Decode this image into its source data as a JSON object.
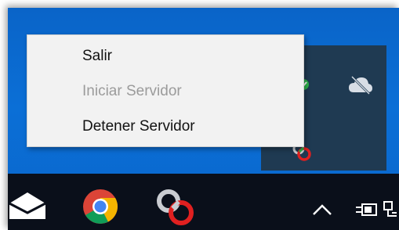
{
  "context_menu": {
    "items": [
      {
        "label": "Salir",
        "enabled": true
      },
      {
        "label": "Iniciar Servidor",
        "enabled": false
      },
      {
        "label": "Detener Servidor",
        "enabled": true
      }
    ]
  },
  "colors": {
    "desktop": "#0b6fd6",
    "tray_flyout": "#1f3a52",
    "taskbar": "#0a0f1a",
    "menu_bg": "#f2f2f2",
    "disabled_text": "#9b9b9b",
    "server_icon_red": "#e02020",
    "server_icon_green": "#2db34a"
  },
  "tray_icons": [
    "server-status-icon-green",
    "cloud-offline-icon",
    "server-status-icon-red"
  ],
  "taskbar_icons": [
    "mail-icon",
    "chrome-icon",
    "server-app-icon",
    "chevron-up-icon",
    "power-plug-icon",
    "network-icon"
  ]
}
